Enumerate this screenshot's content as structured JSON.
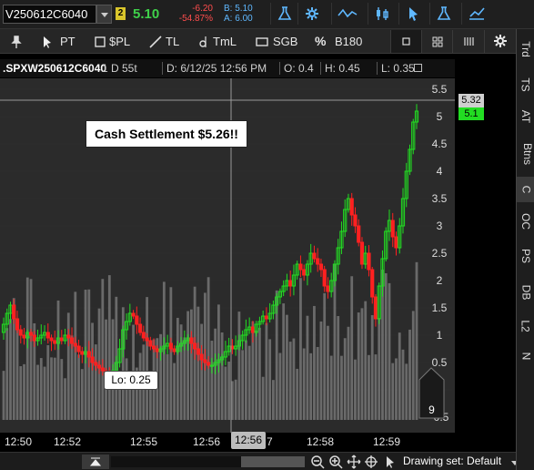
{
  "header": {
    "symbol": "V250612C6040",
    "link_badge": "2",
    "last_price": "5.10",
    "net_change": "-6.20",
    "net_change_pct": "-54.87%",
    "bid": "B: 5.10",
    "ask": "A: 6.00",
    "icons": [
      "flask-icon",
      "gear-icon",
      "trend-line-icon",
      "candles-icon",
      "cursor-icon",
      "flask-icon",
      "chart-style-icon"
    ]
  },
  "toolbar": {
    "pt_label": "PT",
    "spl_label": "$PL",
    "tl_label": "TL",
    "tml_label": "TmL",
    "sgb_label": "SGB",
    "b180_label": "B180",
    "percent_symbol": "%",
    "icons": [
      "pin-icon",
      "cursor-icon",
      "dollar-icon",
      "trendline-icon",
      "timeline-icon",
      "rectangle-icon",
      "percent-icon",
      "square-icon",
      "grid-icon",
      "layout-icon",
      "gear-icon"
    ]
  },
  "chart_header": {
    "symbol": ".SPXW250612C6040",
    "aggregation": "1 D 55t",
    "date": "D: 6/12/25 12:56 PM",
    "open": "O: 0.4",
    "high": "H: 0.45",
    "low": "L: 0.35"
  },
  "annotations": {
    "callout": "Cash Settlement $5.26!!",
    "lo_label": "Lo: 0.25",
    "price_tag_gray": "5.32",
    "price_tag_green": "5.1",
    "scroll_count": "9"
  },
  "time_axis": {
    "labels": [
      "12:50",
      "12:52",
      "12:55",
      "12:56",
      "12:58",
      "12:59"
    ],
    "crosshair": "12:56",
    "cursor_partial": "7"
  },
  "bottom_bar": {
    "drawing_set": "Drawing set: Default",
    "icons": [
      "zoom-out-icon",
      "zoom-in-icon",
      "pan-icon",
      "crosshair-icon",
      "pan-cursor-icon"
    ]
  },
  "side_tabs": [
    "Trd",
    "TS",
    "AT",
    "Btns",
    "C",
    "OC",
    "PS",
    "DB",
    "L2",
    "N"
  ],
  "selected_side_tab": "C",
  "colors": {
    "up": "#22dd22",
    "down": "#ff2020",
    "volume": "#6a6a6a",
    "last_price_green": "#3fd14a",
    "change_red": "#ff4d4d",
    "bid_ask_blue": "#5fb8ff"
  },
  "chart_data": {
    "type": "candlestick",
    "y_ticks": [
      "5.5",
      "5",
      "4.5",
      "4",
      "3.5",
      "3",
      "2.5",
      "2",
      "1.5",
      "1",
      "0.5",
      "0",
      "-0.5"
    ],
    "ylim": [
      -0.5,
      5.5
    ],
    "x_labels": [
      "12:50",
      "12:52",
      "12:55",
      "12:56",
      "12:58",
      "12:59"
    ],
    "low_annotation": 0.25,
    "last": 5.1,
    "crosshair_price": 5.32,
    "closes": [
      1.2,
      1.4,
      1.55,
      1.3,
      1.1,
      1.0,
      0.95,
      1.05,
      1.0,
      0.9,
      0.95,
      1.0,
      1.05,
      0.95,
      0.9,
      0.85,
      0.95,
      0.9,
      1.0,
      0.95,
      0.85,
      0.8,
      0.7,
      0.65,
      0.7,
      0.6,
      0.5,
      0.45,
      0.4,
      0.35,
      0.3,
      0.25,
      0.35,
      0.5,
      0.75,
      1.1,
      1.25,
      1.4,
      1.35,
      1.2,
      1.05,
      0.95,
      0.9,
      0.8,
      0.75,
      0.7,
      0.75,
      0.8,
      0.85,
      0.75,
      0.7,
      0.8,
      0.85,
      0.9,
      0.95,
      0.85,
      0.75,
      0.65,
      0.55,
      0.5,
      0.45,
      0.45,
      0.5,
      0.55,
      0.6,
      0.7,
      0.8,
      0.75,
      0.8,
      0.9,
      1.0,
      1.1,
      1.15,
      1.05,
      1.2,
      1.25,
      1.35,
      1.3,
      1.4,
      1.55,
      1.7,
      1.8,
      1.9,
      2.0,
      1.9,
      2.1,
      2.3,
      2.2,
      2.1,
      2.3,
      2.5,
      2.4,
      2.3,
      2.2,
      1.9,
      1.8,
      2.0,
      2.3,
      2.6,
      2.9,
      3.3,
      3.5,
      3.2,
      3.0,
      2.7,
      2.3,
      2.5,
      2.2,
      1.7,
      1.3,
      1.9,
      2.4,
      2.9,
      3.1,
      2.8,
      2.6,
      3.0,
      3.5,
      4.0,
      4.4,
      4.9,
      5.1
    ]
  }
}
